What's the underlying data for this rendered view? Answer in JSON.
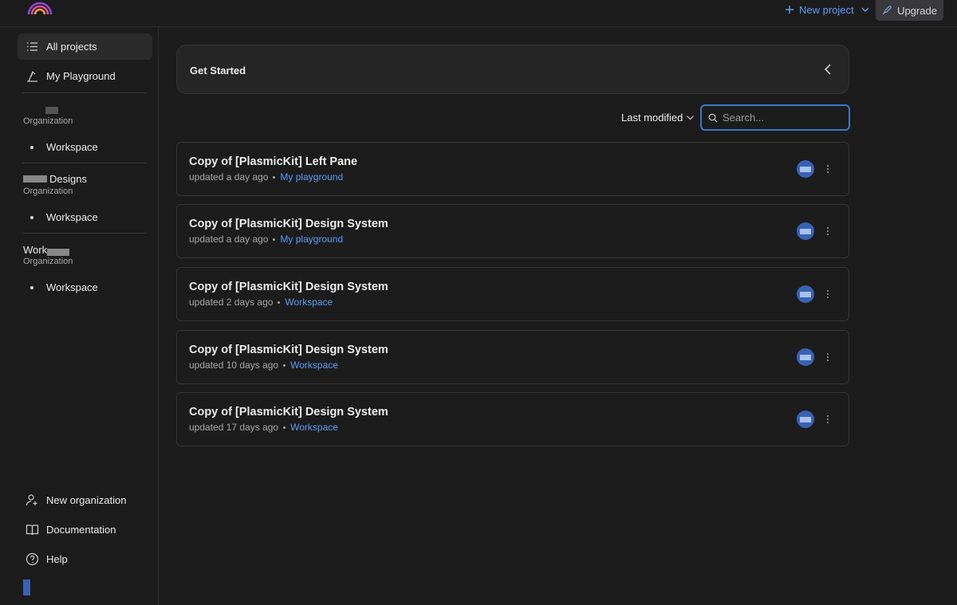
{
  "header": {
    "new_project_label": "New project",
    "upgrade_label": "Upgrade"
  },
  "sidebar": {
    "nav": [
      {
        "label": "All projects",
        "icon": "list-icon"
      },
      {
        "label": "My Playground",
        "icon": "playground-icon"
      }
    ],
    "orgs": [
      {
        "name": "",
        "type": "Organization",
        "workspace": "Workspace"
      },
      {
        "name": "Designs",
        "type": "Organization",
        "workspace": "Workspace"
      },
      {
        "name": "Work",
        "type": "Organization",
        "workspace": "Workspace"
      }
    ],
    "footer": [
      {
        "label": "New organization",
        "icon": "add-user-icon"
      },
      {
        "label": "Documentation",
        "icon": "book-icon"
      },
      {
        "label": "Help",
        "icon": "help-icon"
      }
    ]
  },
  "main": {
    "get_started_label": "Get Started",
    "sort_label": "Last modified",
    "search_placeholder": "Search...",
    "projects": [
      {
        "name": "Copy of [PlasmicKit] Left Pane",
        "updated": "updated a day ago",
        "location": "My playground"
      },
      {
        "name": "Copy of [PlasmicKit] Design System",
        "updated": "updated a day ago",
        "location": "My playground"
      },
      {
        "name": "Copy of [PlasmicKit] Design System",
        "updated": "updated 2 days ago",
        "location": "Workspace"
      },
      {
        "name": "Copy of [PlasmicKit] Design System",
        "updated": "updated 10 days ago",
        "location": "Workspace"
      },
      {
        "name": "Copy of [PlasmicKit] Design System",
        "updated": "updated 17 days ago",
        "location": "Workspace"
      }
    ]
  },
  "colors": {
    "background": "#1c1c1c",
    "accent": "#5b9cf5",
    "avatar": "#3a62b3"
  }
}
